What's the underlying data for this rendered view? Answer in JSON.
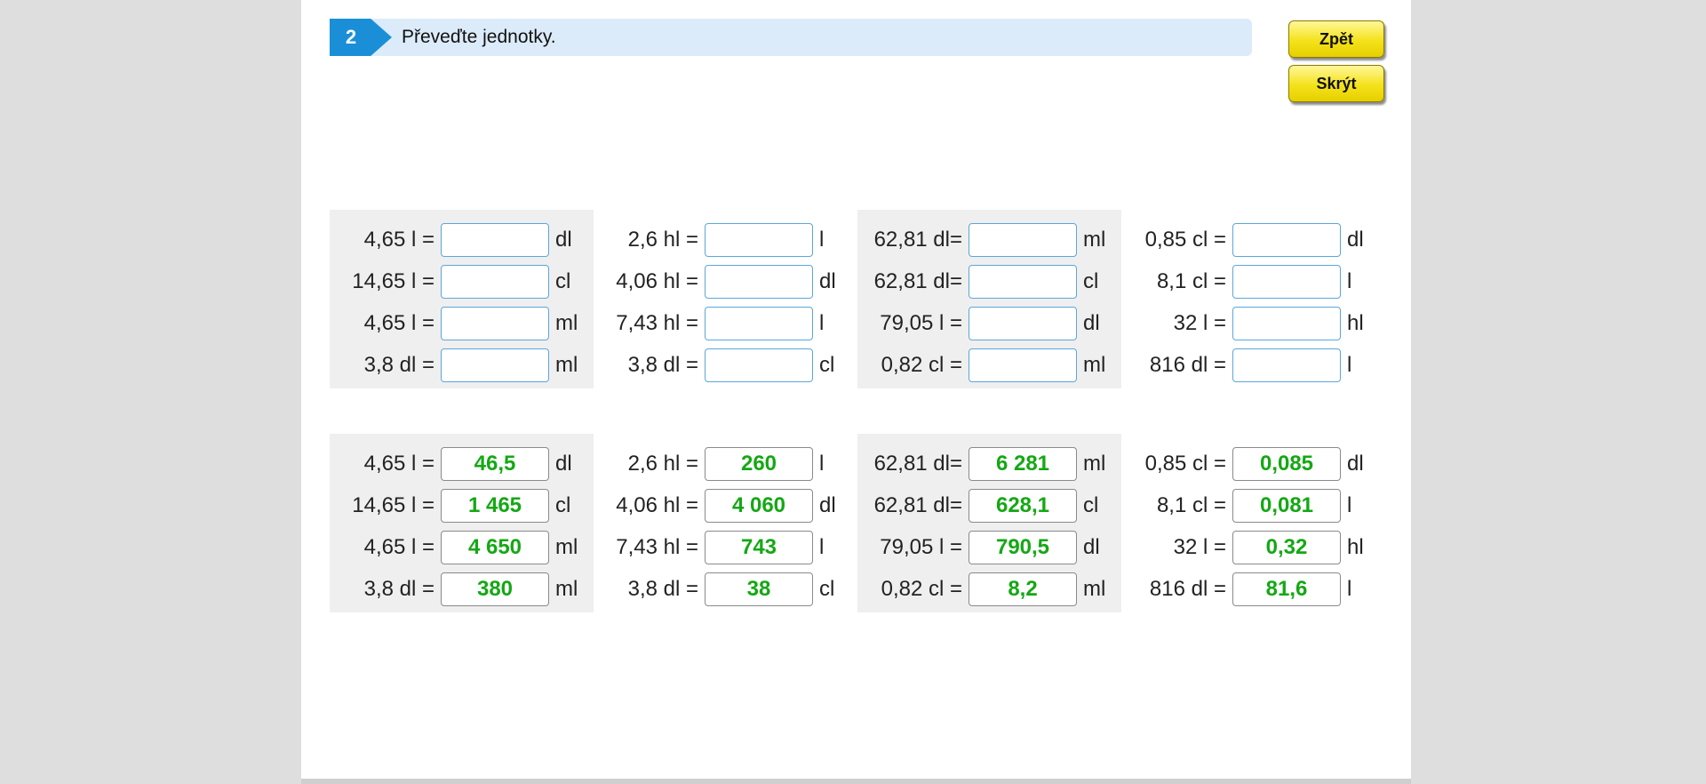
{
  "task": {
    "number": "2",
    "instruction": "Převeďte jednotky."
  },
  "buttons": {
    "back_label": "Zpět",
    "hide_label": "Skrýt"
  },
  "exercises": {
    "columns": [
      [
        {
          "lhs": "4,65 l =",
          "unit": "dl",
          "answer": "46,5"
        },
        {
          "lhs": "14,65 l =",
          "unit": "cl",
          "answer": "1 465"
        },
        {
          "lhs": "4,65 l =",
          "unit": "ml",
          "answer": "4 650"
        },
        {
          "lhs": "3,8 dl =",
          "unit": "ml",
          "answer": "380"
        }
      ],
      [
        {
          "lhs": "2,6 hl =",
          "unit": "l",
          "answer": "260"
        },
        {
          "lhs": "4,06 hl =",
          "unit": "dl",
          "answer": "4 060"
        },
        {
          "lhs": "7,43 hl =",
          "unit": "l",
          "answer": "743"
        },
        {
          "lhs": "3,8 dl =",
          "unit": "cl",
          "answer": "38"
        }
      ],
      [
        {
          "lhs": "62,81 dl=",
          "unit": "ml",
          "answer": "6 281"
        },
        {
          "lhs": "62,81 dl=",
          "unit": "cl",
          "answer": "628,1"
        },
        {
          "lhs": "79,05 l =",
          "unit": "dl",
          "answer": "790,5"
        },
        {
          "lhs": "0,82 cl =",
          "unit": "ml",
          "answer": "8,2"
        }
      ],
      [
        {
          "lhs": "0,85 cl =",
          "unit": "dl",
          "answer": "0,085"
        },
        {
          "lhs": "8,1 cl =",
          "unit": "l",
          "answer": "0,081"
        },
        {
          "lhs": "32 l =",
          "unit": "hl",
          "answer": "0,32"
        },
        {
          "lhs": "816 dl =",
          "unit": "l",
          "answer": "81,6"
        }
      ]
    ]
  },
  "colors": {
    "accent": "#1a8fd8",
    "answer_green": "#14a814",
    "button_yellow": "#f4e21a"
  }
}
